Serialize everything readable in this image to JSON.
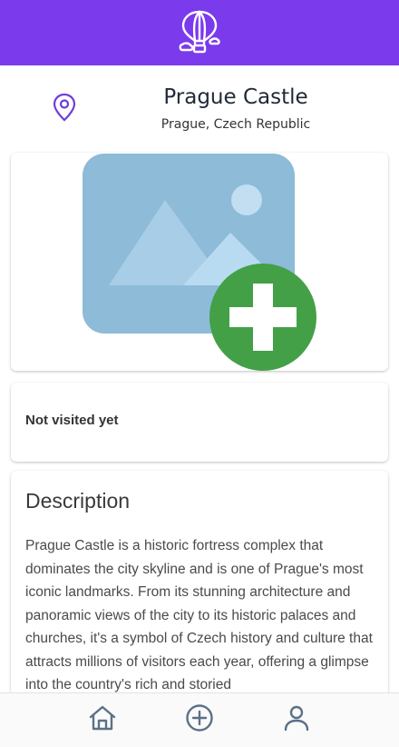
{
  "app_bar": {
    "logo_icon": "hot-air-balloon-icon",
    "color": "#7c3aed"
  },
  "place": {
    "name": "Prague Castle",
    "location": "Prague, Czech Republic",
    "pin_icon": "map-pin-icon"
  },
  "image_card": {
    "placeholder_icon": "image-placeholder-icon",
    "add_icon": "add-photo-icon"
  },
  "status": {
    "text": "Not visited yet"
  },
  "description": {
    "title": "Description",
    "body": "Prague Castle is a historic fortress complex that dominates the city skyline and is one of Prague's most iconic landmarks. From its stunning architecture and panoramic views of the city to its historic palaces and churches, it's a symbol of Czech history and culture that attracts millions of visitors each year, offering a glimpse into the country's rich and storied"
  },
  "bottom_nav": {
    "items": [
      {
        "icon": "home-icon"
      },
      {
        "icon": "add-circle-icon"
      },
      {
        "icon": "profile-icon"
      }
    ]
  }
}
